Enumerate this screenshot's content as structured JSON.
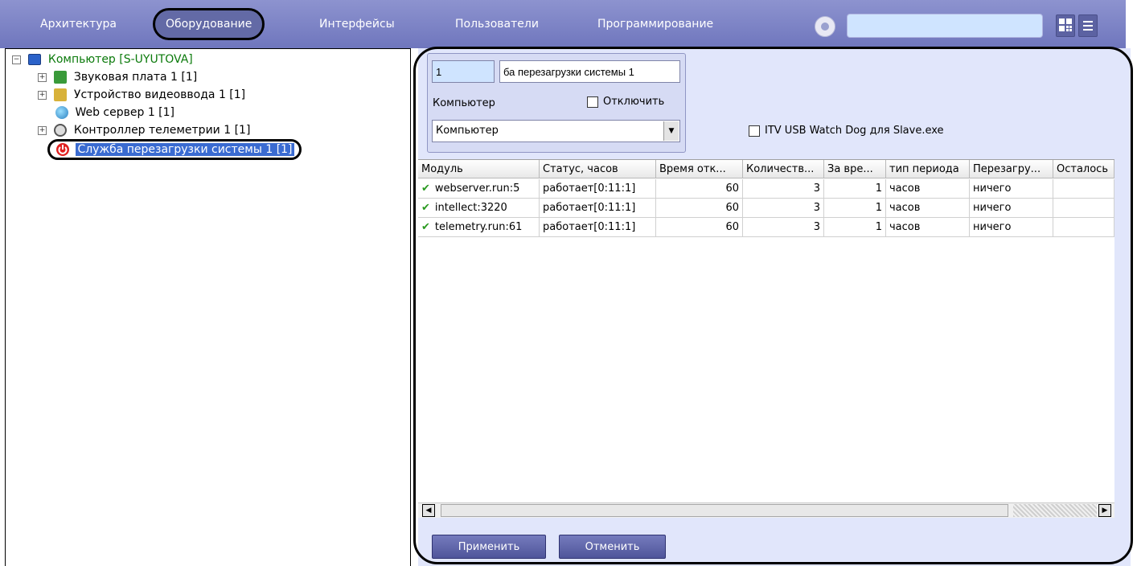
{
  "colors": {
    "topbar": "#7b81c6",
    "panel": "#e1e6fb",
    "status_ok": "#2a9a20"
  },
  "nav": {
    "items": [
      {
        "label": "Архитектура"
      },
      {
        "label": "Оборудование",
        "selected": true
      },
      {
        "label": "Интерфейсы"
      },
      {
        "label": "Пользователи"
      },
      {
        "label": "Программирование"
      }
    ],
    "search_value": "",
    "icons": [
      "settings-icon",
      "layout-grid-icon",
      "menu-icon"
    ]
  },
  "tree": {
    "root": {
      "label": "Компьютер [S-UYUTOVA]",
      "icon": "computer-icon"
    },
    "children": [
      {
        "label": "Звуковая плата 1 [1]",
        "icon": "sound-card-icon",
        "expandable": true
      },
      {
        "label": "Устройство видеоввода 1 [1]",
        "icon": "video-input-icon",
        "expandable": true
      },
      {
        "label": "Web сервер 1 [1]",
        "icon": "web-server-icon",
        "expandable": false
      },
      {
        "label": "Контроллер телеметрии 1 [1]",
        "icon": "telemetry-controller-icon",
        "expandable": true
      },
      {
        "label": "Служба перезагрузки системы 1 [1]",
        "icon": "power-icon",
        "expandable": false,
        "selected": true
      }
    ]
  },
  "form": {
    "id_value": "1",
    "name_value": "ба перезагрузки системы 1",
    "computer_label": "Компьютер",
    "disable_label": "Отключить",
    "disable_checked": false,
    "computer_select": "Компьютер",
    "watchdog_label": "ITV USB Watch Dog для Slave.exe",
    "watchdog_checked": false
  },
  "table": {
    "headers": [
      "Модуль",
      "Статус, часов",
      "Время отк...",
      "Количеств...",
      "За вре...",
      "тип периода",
      "Перезагру...",
      "Осталось"
    ],
    "rows": [
      [
        "webserver.run:5",
        "работает[0:11:1]",
        "60",
        "3",
        "1",
        "часов",
        "ничего",
        ""
      ],
      [
        "intellect:3220",
        "работает[0:11:1]",
        "60",
        "3",
        "1",
        "часов",
        "ничего",
        ""
      ],
      [
        "telemetry.run:61",
        "работает[0:11:1]",
        "60",
        "3",
        "1",
        "часов",
        "ничего",
        ""
      ]
    ]
  },
  "buttons": {
    "apply": "Применить",
    "cancel": "Отменить"
  }
}
